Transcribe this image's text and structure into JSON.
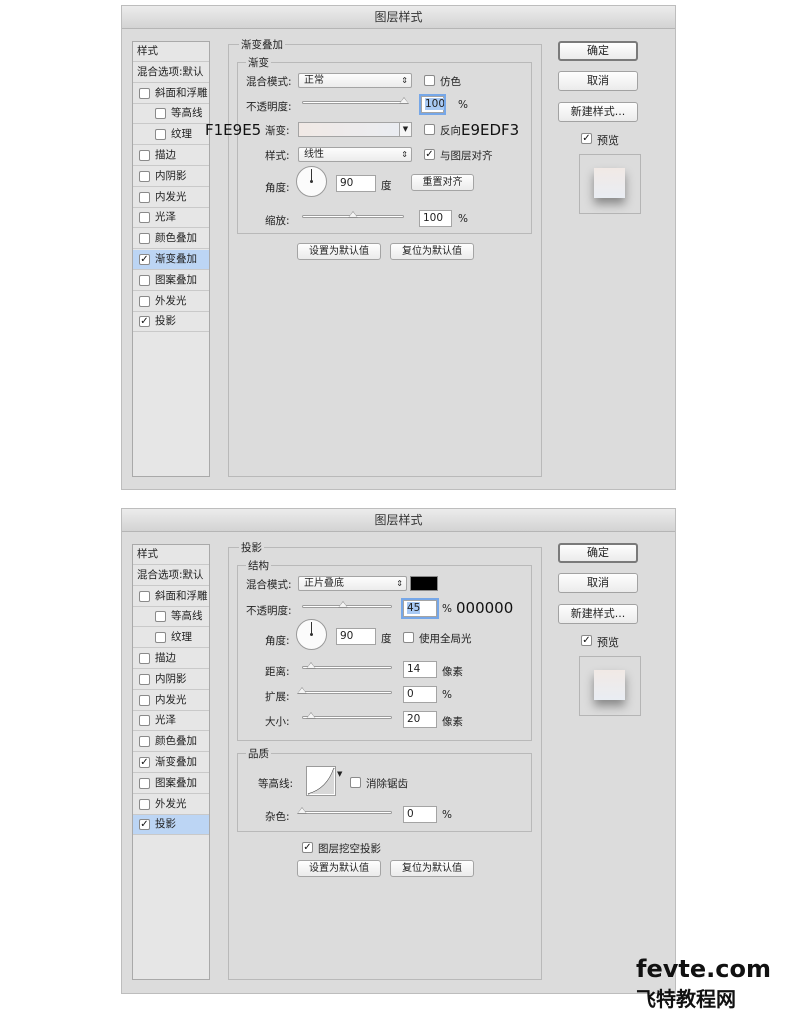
{
  "dialog1": {
    "title": "图层样式",
    "sidebar": [
      {
        "label": "样式",
        "checkbox": false,
        "checked": false,
        "selected": false,
        "indent": 0
      },
      {
        "label": "混合选项:默认",
        "checkbox": false,
        "checked": false,
        "selected": false,
        "indent": 0
      },
      {
        "label": "斜面和浮雕",
        "checkbox": true,
        "checked": false,
        "selected": false,
        "indent": 0
      },
      {
        "label": "等高线",
        "checkbox": true,
        "checked": false,
        "selected": false,
        "indent": 1
      },
      {
        "label": "纹理",
        "checkbox": true,
        "checked": false,
        "selected": false,
        "indent": 1
      },
      {
        "label": "描边",
        "checkbox": true,
        "checked": false,
        "selected": false,
        "indent": 0
      },
      {
        "label": "内阴影",
        "checkbox": true,
        "checked": false,
        "selected": false,
        "indent": 0
      },
      {
        "label": "内发光",
        "checkbox": true,
        "checked": false,
        "selected": false,
        "indent": 0
      },
      {
        "label": "光泽",
        "checkbox": true,
        "checked": false,
        "selected": false,
        "indent": 0
      },
      {
        "label": "颜色叠加",
        "checkbox": true,
        "checked": false,
        "selected": false,
        "indent": 0
      },
      {
        "label": "渐变叠加",
        "checkbox": true,
        "checked": true,
        "selected": true,
        "indent": 0
      },
      {
        "label": "图案叠加",
        "checkbox": true,
        "checked": false,
        "selected": false,
        "indent": 0
      },
      {
        "label": "外发光",
        "checkbox": true,
        "checked": false,
        "selected": false,
        "indent": 0
      },
      {
        "label": "投影",
        "checkbox": true,
        "checked": true,
        "selected": false,
        "indent": 0
      }
    ],
    "group_title": "渐变叠加",
    "subgroup_title": "渐变",
    "blend_label": "混合模式:",
    "blend_value": "正常",
    "dither_label": "仿色",
    "opacity_label": "不透明度:",
    "opacity_value": "100",
    "opacity_unit": "%",
    "opacity_level": 1.0,
    "gradient_label": "渐变:",
    "gradient_start": "#F1E9E5",
    "gradient_end": "#E9EDF3",
    "reverse_label": "反向",
    "style_label": "样式:",
    "style_value": "线性",
    "align_label": "与图层对齐",
    "angle_label": "角度:",
    "angle_value": "90",
    "angle_unit": "度",
    "reset_align": "重置对齐",
    "scale_label": "缩放:",
    "scale_value": "100",
    "scale_unit": "%",
    "scale_level": 0.5,
    "set_default": "设置为默认值",
    "reset_default": "复位为默认值",
    "annot_left": "F1E9E5",
    "annot_right": "E9EDF3",
    "ok": "确定",
    "cancel": "取消",
    "new_style": "新建样式...",
    "preview": "预览"
  },
  "dialog2": {
    "title": "图层样式",
    "sidebar": [
      {
        "label": "样式",
        "checkbox": false,
        "checked": false,
        "selected": false,
        "indent": 0
      },
      {
        "label": "混合选项:默认",
        "checkbox": false,
        "checked": false,
        "selected": false,
        "indent": 0
      },
      {
        "label": "斜面和浮雕",
        "checkbox": true,
        "checked": false,
        "selected": false,
        "indent": 0
      },
      {
        "label": "等高线",
        "checkbox": true,
        "checked": false,
        "selected": false,
        "indent": 1
      },
      {
        "label": "纹理",
        "checkbox": true,
        "checked": false,
        "selected": false,
        "indent": 1
      },
      {
        "label": "描边",
        "checkbox": true,
        "checked": false,
        "selected": false,
        "indent": 0
      },
      {
        "label": "内阴影",
        "checkbox": true,
        "checked": false,
        "selected": false,
        "indent": 0
      },
      {
        "label": "内发光",
        "checkbox": true,
        "checked": false,
        "selected": false,
        "indent": 0
      },
      {
        "label": "光泽",
        "checkbox": true,
        "checked": false,
        "selected": false,
        "indent": 0
      },
      {
        "label": "颜色叠加",
        "checkbox": true,
        "checked": false,
        "selected": false,
        "indent": 0
      },
      {
        "label": "渐变叠加",
        "checkbox": true,
        "checked": true,
        "selected": false,
        "indent": 0
      },
      {
        "label": "图案叠加",
        "checkbox": true,
        "checked": false,
        "selected": false,
        "indent": 0
      },
      {
        "label": "外发光",
        "checkbox": true,
        "checked": false,
        "selected": false,
        "indent": 0
      },
      {
        "label": "投影",
        "checkbox": true,
        "checked": true,
        "selected": true,
        "indent": 0
      }
    ],
    "group_title": "投影",
    "structure_title": "结构",
    "blend_label": "混合模式:",
    "blend_value": "正片叠底",
    "shadow_color": "#000000",
    "opacity_label": "不透明度:",
    "opacity_value": "45",
    "opacity_unit": "%",
    "opacity_level": 0.45,
    "annot_color": "000000",
    "angle_label": "角度:",
    "angle_value": "90",
    "angle_unit": "度",
    "global_light": "使用全局光",
    "distance_label": "距离:",
    "distance_value": "14",
    "distance_unit": "像素",
    "distance_level": 0.1,
    "spread_label": "扩展:",
    "spread_value": "0",
    "spread_unit": "%",
    "spread_level": 0.0,
    "size_label": "大小:",
    "size_value": "20",
    "size_unit": "像素",
    "size_level": 0.1,
    "quality_title": "品质",
    "contour_label": "等高线:",
    "antialias": "消除锯齿",
    "noise_label": "杂色:",
    "noise_value": "0",
    "noise_unit": "%",
    "noise_level": 0.0,
    "knockout": "图层挖空投影",
    "set_default": "设置为默认值",
    "reset_default": "复位为默认值",
    "ok": "确定",
    "cancel": "取消",
    "new_style": "新建样式...",
    "preview": "预览"
  },
  "watermark": {
    "line1": "fevte.com",
    "line2": "飞特教程网"
  }
}
